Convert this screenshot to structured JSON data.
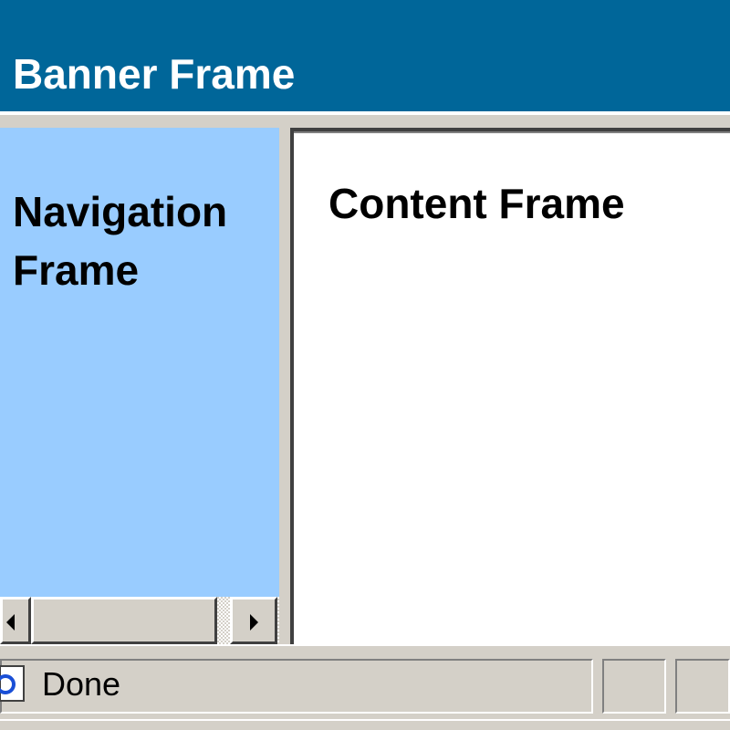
{
  "banner": {
    "title": "Banner Frame",
    "background": "#006699"
  },
  "navigation": {
    "title": "Navigation Frame",
    "background": "#99ccff",
    "scrollbar": {
      "left_icon": "arrow-left-icon",
      "right_icon": "arrow-right-icon"
    }
  },
  "content": {
    "title": "Content Frame",
    "background": "#ffffff"
  },
  "status": {
    "text": "Done",
    "icon": "page-done-icon"
  },
  "colors": {
    "chrome": "#d4d0c8"
  }
}
